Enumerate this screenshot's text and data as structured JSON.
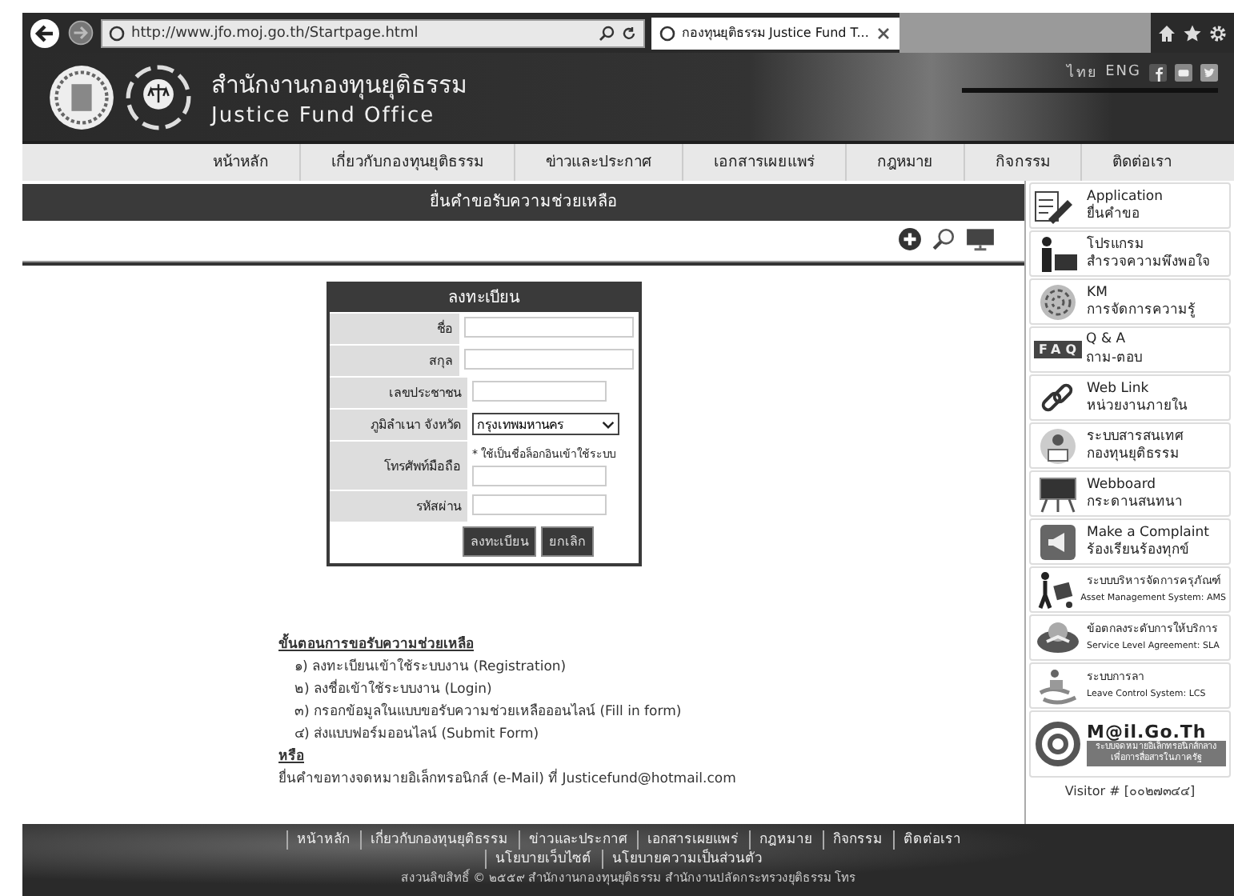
{
  "browser": {
    "url": "http://www.jfo.moj.go.th/Startpage.html",
    "tab": "กองทุนยุติธรรม Justice Fund T..."
  },
  "header": {
    "title_th": "สำนักงานกองทุนยุติธรรม",
    "title_en": "Justice Fund Office",
    "languages": [
      "ไทย",
      "ENG"
    ]
  },
  "nav": [
    "หน้าหลัก",
    "เกี่ยวกับกองทุนยุติธรรม",
    "ข่าวและประกาศ",
    "เอกสารเผยแพร่",
    "กฎหมาย",
    "กิจกรรม",
    "ติดต่อเรา"
  ],
  "page_title": "ยื่นคำขอรับความช่วยเหลือ",
  "register_form": {
    "title": "ลงทะเบียน",
    "fields": [
      {
        "label": "ชื่อ",
        "kind": "text"
      },
      {
        "label": "สกุล",
        "kind": "text"
      },
      {
        "label": "เลขประชาชน",
        "kind": "text"
      },
      {
        "label": "ภูมิลำเนา จังหวัด",
        "kind": "select",
        "value": "กรุงเทพมหานคร"
      },
      {
        "label": "โทรศัพท์มือถือ",
        "kind": "text",
        "note": "* ใช้เป็นชื่อล็อกอินเข้าใช้ระบบ"
      },
      {
        "label": "รหัสผ่าน",
        "kind": "password"
      }
    ],
    "buttons": [
      "ลงทะเบียน",
      "ยกเลิก"
    ]
  },
  "instructions": {
    "heading": "ขั้นตอนการขอรับความช่วยเหลือ",
    "steps": [
      "๑) ลงทะเบียนเข้าใช้ระบบงาน (Registration)",
      "๒) ลงชื่อเข้าใช้ระบบงาน (Login)",
      "๓) กรอกข้อมูลในแบบขอรับความช่วยเหลือออนไลน์ (Fill in form)",
      "๔) ส่งแบบฟอร์มออนไลน์ (Submit Form)"
    ],
    "or": "หรือ",
    "alternative": "ยื่นคำขอทางจดหมายอิเล็กทรอนิกส์ (e-Mail) ที่ Justicefund@hotmail.com"
  },
  "sidebar": [
    {
      "kind": "application",
      "line1": "Application",
      "line2": "ยื่นคำขอ"
    },
    {
      "kind": "survey",
      "line1": "โปรแกรม",
      "line2": "สำรวจความพึงพอใจ"
    },
    {
      "kind": "km",
      "line1": "KM",
      "line2": "การจัดการความรู้"
    },
    {
      "kind": "faq",
      "badge": "FAQ",
      "line1": "Q & A",
      "line2": "ถาม-ตอบ"
    },
    {
      "kind": "link",
      "line1": "Web Link",
      "line2": "หน่วยงานภายใน"
    },
    {
      "kind": "info",
      "line1": "ระบบสารสนเทศ",
      "line2": "กองทุนยุติธรรม"
    },
    {
      "kind": "board",
      "line1": "Webboard",
      "line2": "กระดานสนทนา"
    },
    {
      "kind": "complaint",
      "line1": "Make a Complaint",
      "line2": "ร้องเรียนร้องทุกข์"
    },
    {
      "kind": "asset",
      "line1": "ระบบบริหารจัดการครุภัณฑ์",
      "line2": "Asset Management System: AMS"
    },
    {
      "kind": "sla",
      "line1": "ข้อตกลงระดับการให้บริการ",
      "line2": "Service Level Agreement: SLA"
    },
    {
      "kind": "leave",
      "line1": "ระบบการลา",
      "line2": "Leave Control System: LCS"
    },
    {
      "kind": "mail",
      "line1": "M@il.Go.Th",
      "line2": "ระบบจดหมายอิเล็กทรอนิกส์กลาง เพื่อการสื่อสารในภาครัฐ"
    }
  ],
  "visitor": "Visitor # [๐๐๒๗๓๔๔]",
  "footer": {
    "links": [
      "หน้าหลัก",
      "เกี่ยวกับกองทุนยุติธรรม",
      "ข่าวและประกาศ",
      "เอกสารเผยแพร่",
      "กฎหมาย",
      "กิจกรรม",
      "ติดต่อเรา"
    ],
    "policies": [
      "นโยบายเว็บไซต์",
      "นโยบายความเป็นส่วนตัว"
    ],
    "copyright": "สงวนลิขสิทธิ์ © ๒๕๕๙ สำนักงานกองทุนยุติธรรม สำนักงานปลัดกระทรวงยุติธรรม โทร"
  }
}
